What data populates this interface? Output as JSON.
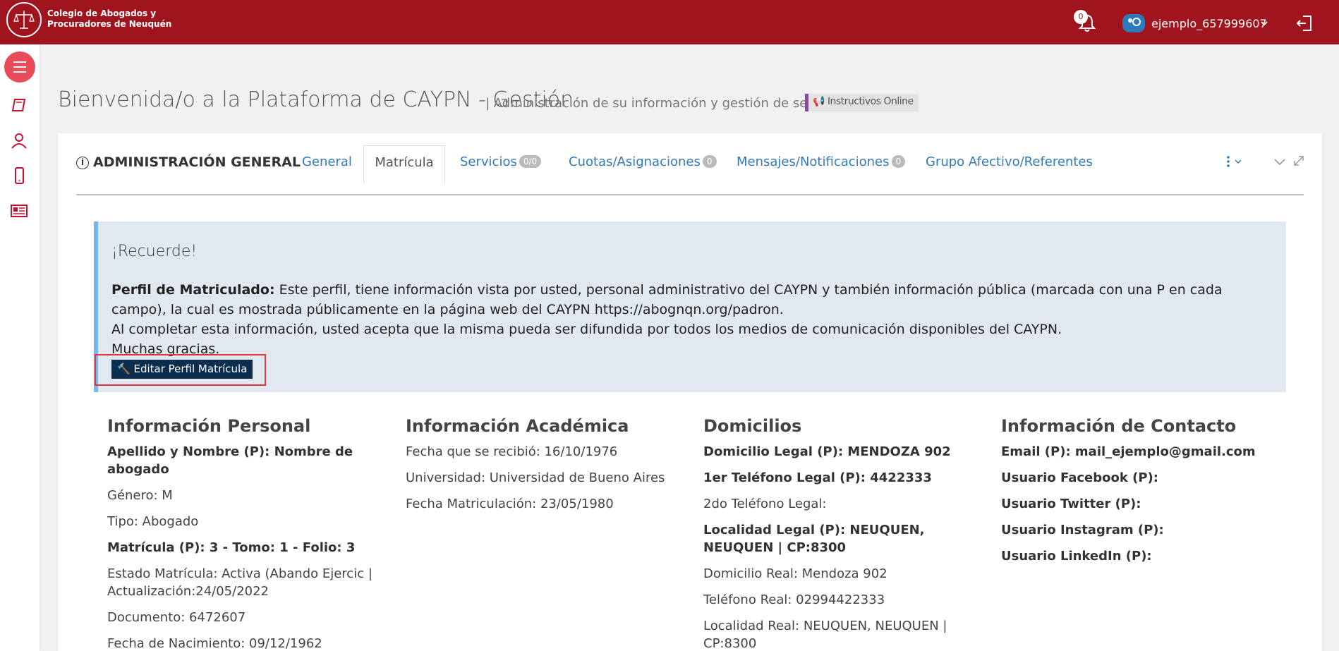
{
  "header": {
    "brand_line1": "Colegio de Abogados y",
    "brand_line2": "Procuradores de Neuquén",
    "notifications_count": "0",
    "username": "ejemplo_657999607",
    "caret": "⌄"
  },
  "page": {
    "title": "Bienvenida/o a la Plataforma de CAYPN - Gestión",
    "subtitle": "| Administración de su información y gestión de servicios",
    "instructivos": "Instructivos Online"
  },
  "card": {
    "title": "ADMINISTRACIÓN GENERAL",
    "tabs": {
      "general": "General",
      "matricula": "Matrícula",
      "servicios": "Servicios",
      "servicios_badge": "0/0",
      "cuotas": "Cuotas/Asignaciones",
      "cuotas_badge": "0",
      "mensajes": "Mensajes/Notificaciones",
      "mensajes_badge": "0",
      "grupo": "Grupo Afectivo/Referentes"
    }
  },
  "alert": {
    "title": "¡Recuerde!",
    "bold_label": "Perfil de Matriculado:",
    "text1": " Este perfil, tiene información vista por usted, personal administrativo del CAYPN y también información pública (marcada con una P en cada campo), la cual es mostrada públicamente en la página web del CAYPN https://abognqn.org/padron.",
    "text2": "Al completar esta información, usted acepta que la misma pueda ser difundida por todos los medios de comunicación disponibles del CAYPN.",
    "text3": "Muchas gracias.",
    "edit_button": "Editar Perfil Matrícula"
  },
  "personal": {
    "title": "Información Personal",
    "nombre": "Apellido y Nombre (P): Nombre de abogado",
    "genero": "Género: M",
    "tipo": "Tipo: Abogado",
    "matricula": "Matrícula (P): 3 - Tomo: 1 - Folio: 3",
    "estado": "Estado Matrícula: Activa (Abando Ejercic | Actualización:24/05/2022",
    "documento": "Documento: 6472607",
    "nacimiento": "Fecha de Nacimiento: 09/12/1962"
  },
  "academica": {
    "title": "Información Académica",
    "recibio": "Fecha que se recibió: 16/10/1976",
    "universidad": "Universidad: Universidad de Bueno Aires",
    "matriculacion": "Fecha Matriculación: 23/05/1980"
  },
  "domicilios": {
    "title": "Domicilios",
    "legal": "Domicilio Legal (P): MENDOZA 902",
    "tel1": "1er Teléfono Legal (P): 4422333",
    "tel2": "2do Teléfono Legal:",
    "localidad_legal": "Localidad Legal (P): NEUQUEN, NEUQUEN | CP:8300",
    "real": "Domicilio Real: Mendoza 902",
    "tel_real": "Teléfono Real: 02994422333",
    "localidad_real": "Localidad Real: NEUQUEN, NEUQUEN | CP:8300"
  },
  "contacto": {
    "title": "Información de Contacto",
    "email": "Email (P): mail_ejemplo@gmail.com",
    "facebook": "Usuario Facebook (P):",
    "twitter": "Usuario Twitter (P):",
    "instagram": "Usuario Instagram (P):",
    "linkedin": "Usuario LinkedIn (P):"
  }
}
